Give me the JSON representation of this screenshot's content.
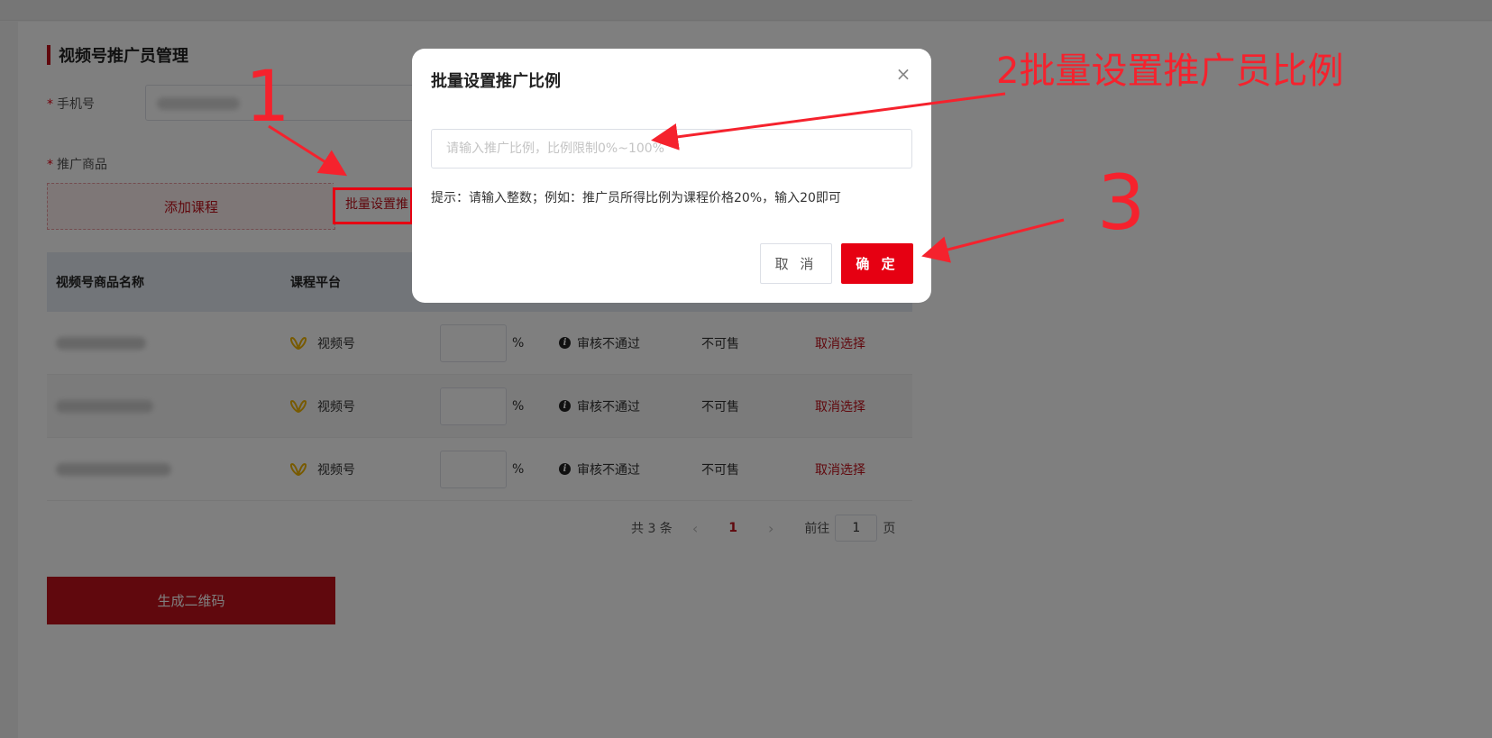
{
  "page": {
    "title": "视频号推广员管理",
    "phone_label": "手机号",
    "product_label": "推广商品",
    "required_mark": "*",
    "add_course_label": "添加课程",
    "batch_set_label": "批量设置推",
    "generate_label": "生成二维码"
  },
  "table": {
    "headers": [
      "视频号商品名称",
      "课程平台"
    ],
    "rows": [
      {
        "platform": "视频号",
        "unit": "%",
        "status": "审核不通过",
        "sale": "不可售",
        "action": "取消选择"
      },
      {
        "platform": "视频号",
        "unit": "%",
        "status": "审核不通过",
        "sale": "不可售",
        "action": "取消选择"
      },
      {
        "platform": "视频号",
        "unit": "%",
        "status": "审核不通过",
        "sale": "不可售",
        "action": "取消选择"
      }
    ],
    "info_glyph": "i"
  },
  "pager": {
    "total": "共 3 条",
    "prev": "‹",
    "current": "1",
    "next": "›",
    "goto_label": "前往",
    "goto_value": "1",
    "page_suffix": "页"
  },
  "modal": {
    "title": "批量设置推广比例",
    "close": "×",
    "placeholder": "请输入推广比例，比例限制0%~100%",
    "hint": "提示：请输入整数；例如：推广员所得比例为课程价格20%，输入20即可",
    "cancel": "取 消",
    "ok": "确 定"
  },
  "annotations": {
    "step1": "1",
    "step2": "2批量设置推广员比例",
    "step3": "3",
    "color": "#f5222d"
  },
  "colors": {
    "brand": "#c0101a",
    "primary_button": "#e60012",
    "platform_icon": "#f0b400"
  },
  "icons": {
    "platform": "wechat-channels-icon",
    "info": "info-icon",
    "close": "close-icon",
    "prev": "chevron-left-icon",
    "next": "chevron-right-icon"
  }
}
